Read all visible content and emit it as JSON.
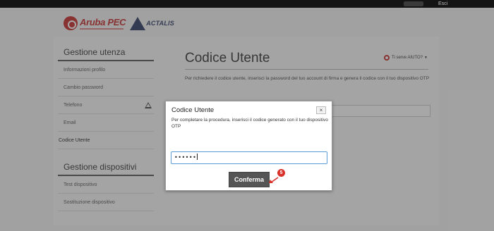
{
  "topbar": {
    "exit_label": "Esci"
  },
  "logos": {
    "aruba": "Aruba PEC",
    "actalis": "ACTALIS"
  },
  "sidebar": {
    "section1_title": "Gestione utenza",
    "items1": [
      "Informazioni profilo",
      "Cambio password",
      "Telefono",
      "Email",
      "Codice Utente"
    ],
    "section2_title": "Gestione dispositivi",
    "items2": [
      "Test dispositivo",
      "Sostituzione dispositivo"
    ]
  },
  "main": {
    "title": "Codice Utente",
    "help_label": "Ti serve AIUTO?",
    "description": "Per richiedere il codice utente, inserisci la password del tuo account di firma e genera il codice con il tuo dispositivo OTP"
  },
  "modal": {
    "title": "Codice Utente",
    "close_label": "×",
    "text": "Per completare la procedura, inserisci il codice generato con il tuo dispositivo OTP",
    "otp_value": "••••••",
    "confirm_label": "Conferma"
  },
  "annotation": {
    "step": "5"
  },
  "colors": {
    "accent_red": "#d8312a",
    "aruba_red": "#c62a2a",
    "actalis_blue": "#2b3b63",
    "input_focus": "#5b9bd5",
    "button": "#555555"
  }
}
